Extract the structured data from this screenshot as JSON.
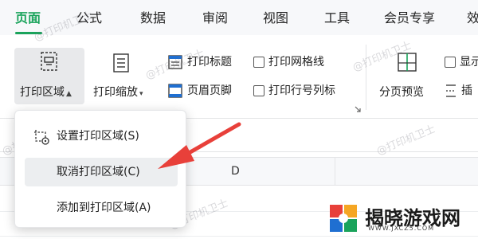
{
  "tabs": [
    {
      "label": "页面",
      "active": true
    },
    {
      "label": "公式"
    },
    {
      "label": "数据"
    },
    {
      "label": "审阅"
    },
    {
      "label": "视图"
    },
    {
      "label": "工具"
    },
    {
      "label": "会员专享"
    },
    {
      "label": "效"
    }
  ],
  "ribbon": {
    "print_area": {
      "label": "打印区域",
      "icon": "print-area-icon",
      "pressed": true
    },
    "print_scale": {
      "label": "打印缩放",
      "icon": "print-scale-icon"
    },
    "print_titles": {
      "label": "打印标题",
      "icon": "print-titles-icon"
    },
    "header_footer": {
      "label": "页眉页脚",
      "icon": "header-footer-icon"
    },
    "print_gridlines": {
      "label": "打印网格线",
      "checked": false
    },
    "print_row_col_headings": {
      "label": "打印行号列标",
      "checked": false
    },
    "page_break_preview": {
      "label": "分页预览",
      "icon": "page-break-preview-icon"
    },
    "show": {
      "label": "显示",
      "checked": false
    },
    "insert": {
      "label": "插",
      "icon": "insert-page-break-icon"
    }
  },
  "sheet": {
    "column_label": "D"
  },
  "menu": {
    "items": [
      {
        "label": "设置打印区域(S)",
        "icon": "set-print-area-icon"
      },
      {
        "label": "取消打印区域(C)",
        "highlighted": true
      },
      {
        "label": "添加到打印区域(A)"
      }
    ]
  },
  "watermark": {
    "text": "@打印机卫士"
  },
  "brand": {
    "name": "揭晓游戏网",
    "sub": "WWW.JXCZ5.COM"
  },
  "colors": {
    "accent": "#1aa35b",
    "arrow": "#e8403a",
    "hover": "#eceef0"
  }
}
